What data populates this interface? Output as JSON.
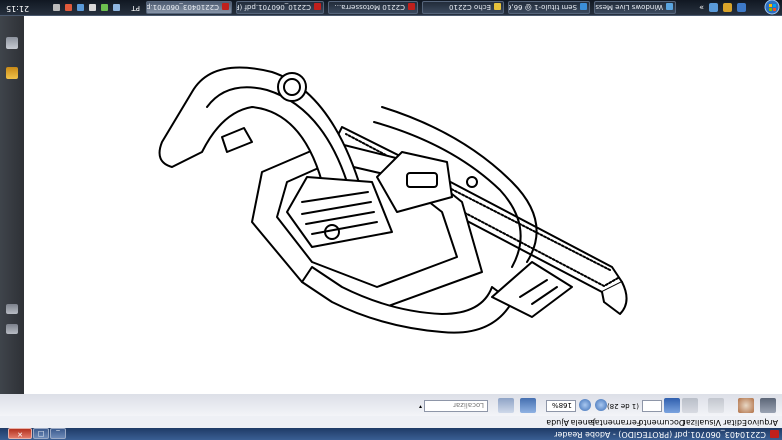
{
  "window": {
    "title": "C2210403_060701.pdf (PROTEGIDO) - Adobe Reader"
  },
  "menu": {
    "items": [
      "Arquivo",
      "Editar",
      "Visualizar",
      "Documento",
      "Ferramentas",
      "Janela",
      "Ajuda"
    ]
  },
  "toolbar": {
    "page_current": "",
    "page_total": "(1 de 28)",
    "zoom": "168%",
    "find_placeholder": "Localizar"
  },
  "taskbar": {
    "tasks": [
      {
        "label": "Windows Live Mess...",
        "active": false
      },
      {
        "label": "Sem título-1 @ 66,6...",
        "active": false
      },
      {
        "label": "Echo C2210",
        "active": false
      },
      {
        "label": "C2210 Motosserra...",
        "active": false
      },
      {
        "label": "C2210_060701.pdf (P...",
        "active": false
      },
      {
        "label": "C2210403_060701.p...",
        "active": true
      }
    ],
    "tray": {
      "lang": "PT",
      "clock": "21:15"
    }
  },
  "icons": {
    "app": "adobe-reader-icon",
    "start": "windows-start-orb-icon",
    "nav": [
      "pages-icon",
      "attachments-icon",
      "layers-icon",
      "signatures-icon"
    ]
  },
  "colors": {
    "titlebar": "#1f3b66",
    "navpanel": "#2e3136",
    "taskbar": "#0f1620",
    "close": "#b2311f"
  }
}
